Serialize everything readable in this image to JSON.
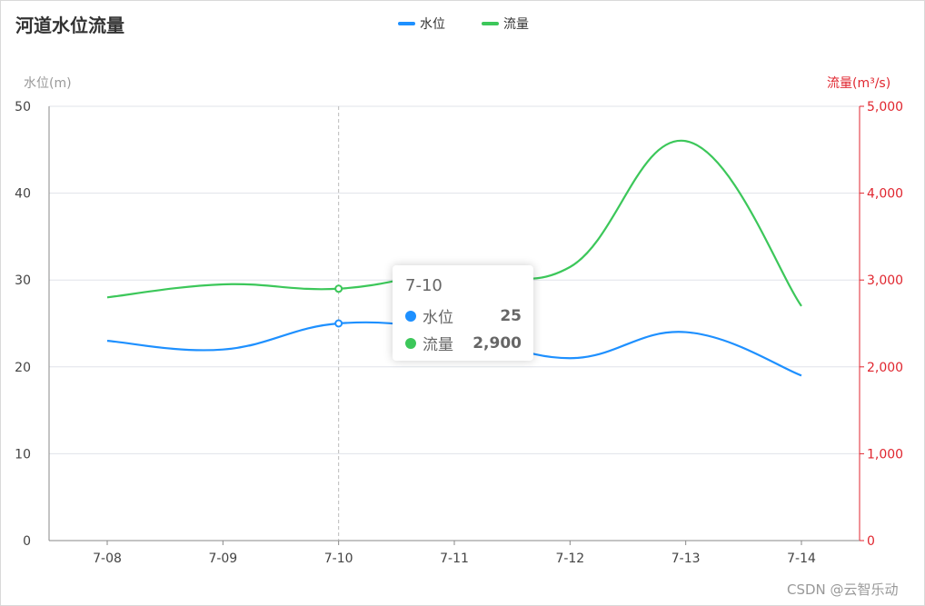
{
  "chart_data": {
    "type": "line",
    "title": "河道水位流量",
    "categories": [
      "7-08",
      "7-09",
      "7-10",
      "7-11",
      "7-12",
      "7-13",
      "7-14"
    ],
    "series": [
      {
        "name": "水位",
        "axis": "left",
        "color": "#1e90ff",
        "values": [
          23,
          22,
          25,
          24,
          21,
          24,
          19
        ]
      },
      {
        "name": "流量",
        "axis": "right",
        "color": "#3cc75a",
        "values": [
          2800,
          2950,
          2900,
          3100,
          3150,
          4600,
          2700
        ]
      }
    ],
    "left_axis": {
      "name": "水位(m)",
      "ylim": [
        0,
        50
      ],
      "ticks": [
        "0",
        "10",
        "20",
        "30",
        "40",
        "50"
      ],
      "color": "#999999"
    },
    "right_axis": {
      "name": "流量(m³/s)",
      "ylim": [
        0,
        5000
      ],
      "ticks": [
        "0",
        "1,000",
        "2,000",
        "3,000",
        "4,000",
        "5,000"
      ],
      "color": "#e0262f"
    },
    "grid": true,
    "legend_position": "top-center",
    "smooth": true
  },
  "tooltip": {
    "title": "7-10",
    "rows": [
      {
        "label": "水位",
        "value": "25",
        "color": "#1e90ff"
      },
      {
        "label": "流量",
        "value": "2,900",
        "color": "#3cc75a"
      }
    ]
  },
  "watermark": "CSDN @云智乐动"
}
